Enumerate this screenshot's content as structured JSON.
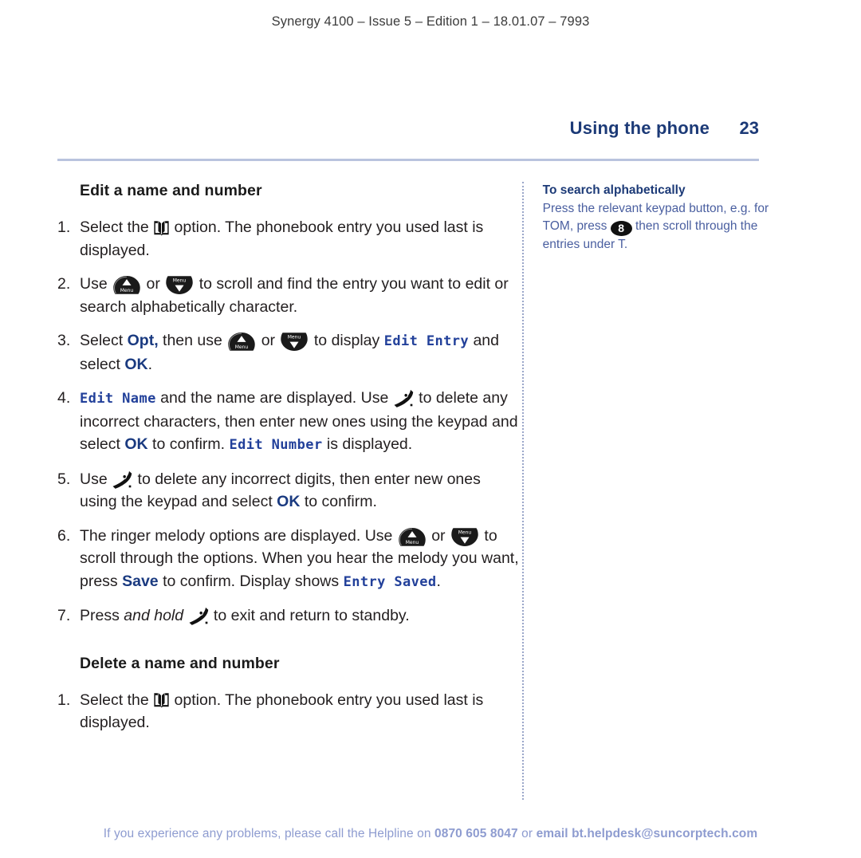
{
  "document": {
    "running_header": "Synergy 4100 – Issue 5 – Edition 1 – 18.01.07 – 7993",
    "section_title": "Using the phone",
    "page_number": "23"
  },
  "colors": {
    "navy": "#1c3a77",
    "lcd_blue": "#22409a",
    "rule_blue": "#b9c3de",
    "footer_blue": "#8e9cd0",
    "side_body_blue": "#4a5fa0",
    "body_text": "#231f20"
  },
  "main": {
    "sections": [
      {
        "heading": "Edit a name and number",
        "steps": [
          {
            "num": "1.",
            "parts": [
              {
                "type": "text",
                "value": "Select the "
              },
              {
                "type": "icon",
                "icon": "phonebook-book-icon"
              },
              {
                "type": "text",
                "value": " option. The phonebook entry you used last is displayed."
              }
            ]
          },
          {
            "num": "2.",
            "parts": [
              {
                "type": "text",
                "value": "Use "
              },
              {
                "type": "icon",
                "icon": "nav-up-menu-icon"
              },
              {
                "type": "text",
                "value": " or "
              },
              {
                "type": "icon",
                "icon": "nav-down-menu-icon"
              },
              {
                "type": "text",
                "value": " to scroll and find the entry you want to edit or search alphabetically character."
              }
            ]
          },
          {
            "num": "3.",
            "parts": [
              {
                "type": "text",
                "value": "Select "
              },
              {
                "type": "bold",
                "value": "Opt,"
              },
              {
                "type": "text",
                "value": " then use "
              },
              {
                "type": "icon",
                "icon": "nav-up-menu-icon"
              },
              {
                "type": "text",
                "value": " or "
              },
              {
                "type": "icon",
                "icon": "nav-down-menu-icon"
              },
              {
                "type": "text",
                "value": " to display "
              },
              {
                "type": "lcd",
                "value": "Edit Entry"
              },
              {
                "type": "text",
                "value": " and select "
              },
              {
                "type": "bold",
                "value": "OK"
              },
              {
                "type": "text",
                "value": "."
              }
            ]
          },
          {
            "num": "4.",
            "parts": [
              {
                "type": "lcd",
                "value": "Edit Name"
              },
              {
                "type": "text",
                "value": " and the name are displayed. Use "
              },
              {
                "type": "icon",
                "icon": "hangup-handset-icon"
              },
              {
                "type": "text",
                "value": " to delete any incorrect characters, then enter new ones using the keypad and select "
              },
              {
                "type": "bold",
                "value": "OK"
              },
              {
                "type": "text",
                "value": " to confirm. "
              },
              {
                "type": "lcd",
                "value": "Edit Number"
              },
              {
                "type": "text",
                "value": " is displayed."
              }
            ]
          },
          {
            "num": "5.",
            "parts": [
              {
                "type": "text",
                "value": "Use "
              },
              {
                "type": "icon",
                "icon": "hangup-handset-icon"
              },
              {
                "type": "text",
                "value": " to delete any incorrect digits, then enter new ones using the keypad and select "
              },
              {
                "type": "bold",
                "value": "OK"
              },
              {
                "type": "text",
                "value": " to confirm."
              }
            ]
          },
          {
            "num": "6.",
            "parts": [
              {
                "type": "text",
                "value": "The ringer melody options are displayed. Use "
              },
              {
                "type": "icon",
                "icon": "nav-up-menu-icon"
              },
              {
                "type": "text",
                "value": " or "
              },
              {
                "type": "icon",
                "icon": "nav-down-menu-icon"
              },
              {
                "type": "text",
                "value": " to scroll through the options. When you hear the melody you want, press "
              },
              {
                "type": "bold",
                "value": "Save"
              },
              {
                "type": "text",
                "value": " to confirm. Display shows "
              },
              {
                "type": "lcd",
                "value": "Entry Saved"
              },
              {
                "type": "text",
                "value": "."
              }
            ]
          },
          {
            "num": "7.",
            "parts": [
              {
                "type": "text",
                "value": "Press "
              },
              {
                "type": "italic",
                "value": "and hold"
              },
              {
                "type": "text",
                "value": " "
              },
              {
                "type": "icon",
                "icon": "hangup-handset-icon"
              },
              {
                "type": "text",
                "value": " to exit and return to standby."
              }
            ]
          }
        ]
      },
      {
        "heading": "Delete a name and number",
        "steps": [
          {
            "num": "1.",
            "parts": [
              {
                "type": "text",
                "value": "Select the "
              },
              {
                "type": "icon",
                "icon": "phonebook-book-icon"
              },
              {
                "type": "text",
                "value": " option. The phonebook entry you used last is displayed."
              }
            ]
          }
        ]
      }
    ]
  },
  "sidebar": {
    "heading": "To search alphabetically",
    "parts": [
      {
        "type": "text",
        "value": "Press the relevant keypad button, e.g. for TOM, press "
      },
      {
        "type": "key",
        "value": "8"
      },
      {
        "type": "text",
        "value": " then scroll through the entries under T."
      }
    ]
  },
  "footer": {
    "parts": [
      {
        "type": "text",
        "value": "If you experience any problems, please call the Helpline on "
      },
      {
        "type": "bold",
        "value": "0870 605 8047"
      },
      {
        "type": "text",
        "value": " or "
      },
      {
        "type": "bold",
        "value": "email bt.helpdesk@suncorptech.com"
      }
    ]
  }
}
